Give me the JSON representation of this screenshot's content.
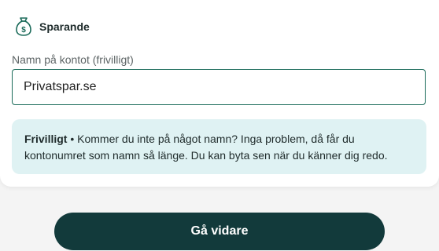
{
  "header": {
    "title": "Sparande",
    "icon": "money-bag-icon"
  },
  "account_name": {
    "label": "Namn på kontot (frivilligt)",
    "value": "Privatspar.se"
  },
  "info": {
    "strong": "Frivilligt",
    "separator": " • ",
    "text": "Kommer du inte på något namn? Inga problem, då får du kontonumret som namn så länge. Du kan byta sen när du känner dig redo."
  },
  "actions": {
    "continue_label": "Gå vidare"
  },
  "colors": {
    "accent": "#1a6a59",
    "info_bg": "#dff2f3",
    "button_bg": "#123a3b"
  }
}
